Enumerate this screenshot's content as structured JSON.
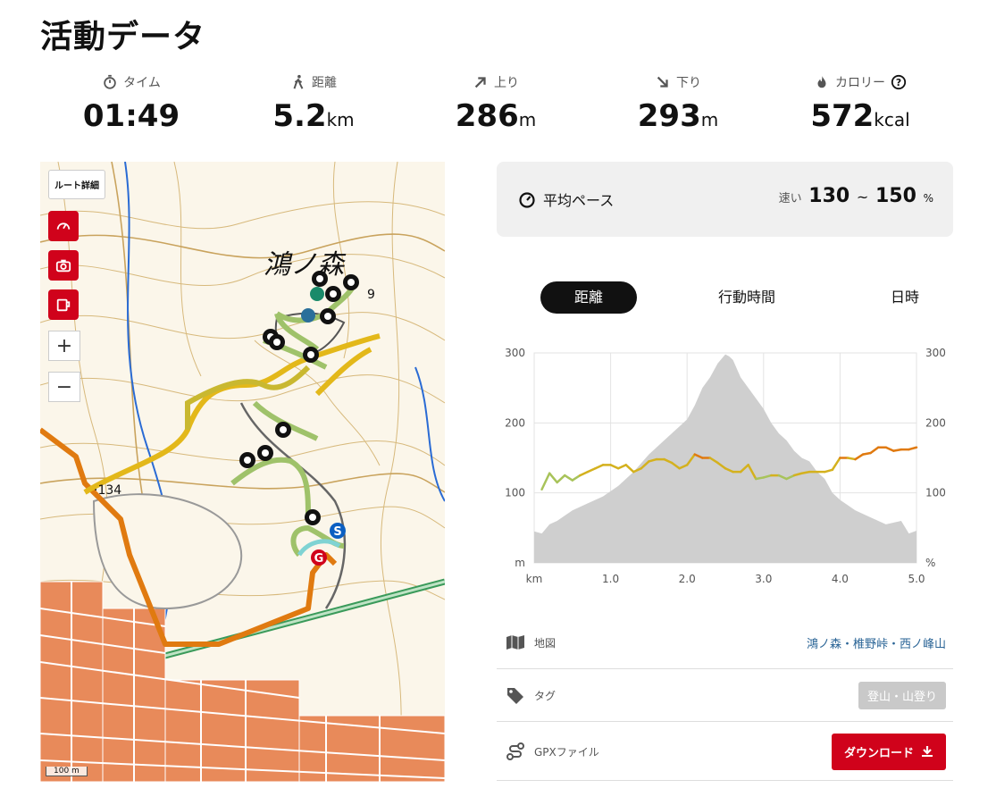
{
  "title": "活動データ",
  "stats": [
    {
      "icon": "stopwatch-icon",
      "label": "タイム",
      "value": "01:49",
      "unit": ""
    },
    {
      "icon": "walker-icon",
      "label": "距離",
      "value": "5.2",
      "unit": "km"
    },
    {
      "icon": "arrow-up-right-icon",
      "label": "上り",
      "value": "286",
      "unit": "m"
    },
    {
      "icon": "arrow-down-right-icon",
      "label": "下り",
      "value": "293",
      "unit": "m"
    },
    {
      "icon": "flame-icon",
      "label": "カロリー",
      "value": "572",
      "unit": "kcal"
    }
  ],
  "map": {
    "route_detail": "ルート詳細",
    "zoom_in": "+",
    "zoom_out": "−",
    "place_label": "鴻ノ森",
    "elev_label": "·134",
    "elev_label2": "9",
    "scale": "100 m",
    "colors": {
      "route_low": "#9fc26a",
      "route_mid": "#e3b81a",
      "route_high": "#e07a10",
      "start": "#0b5fc2",
      "goal": "#d0021b"
    }
  },
  "pace": {
    "label": "平均ペース",
    "prefix": "速い",
    "low": "130",
    "sep": "~",
    "high": "150",
    "unit": "%"
  },
  "tabs": [
    {
      "label": "距離",
      "active": true
    },
    {
      "label": "行動時間",
      "active": false
    },
    {
      "label": "日時",
      "active": false
    }
  ],
  "chart_data": {
    "type": "area",
    "x_unit": "km",
    "left_unit": "m",
    "right_unit": "%",
    "xlim": [
      0,
      5.0
    ],
    "ylim": [
      0,
      300
    ],
    "x_ticks": [
      "km",
      "1.0",
      "2.0",
      "3.0",
      "4.0",
      "5.0"
    ],
    "y_ticks_left": [
      "300",
      "200",
      "100",
      "m"
    ],
    "y_ticks_right": [
      "300",
      "200",
      "100",
      "%"
    ],
    "series": [
      {
        "kind": "elevation",
        "color": "#cfcfcf",
        "x": [
          0,
          0.1,
          0.2,
          0.3,
          0.5,
          0.7,
          0.9,
          1.1,
          1.3,
          1.5,
          1.7,
          1.9,
          2.0,
          2.1,
          2.2,
          2.3,
          2.4,
          2.5,
          2.55,
          2.6,
          2.7,
          2.8,
          2.9,
          3.0,
          3.1,
          3.2,
          3.3,
          3.4,
          3.5,
          3.6,
          3.7,
          3.8,
          3.9,
          4.0,
          4.2,
          4.4,
          4.6,
          4.8,
          4.9,
          5.0
        ],
        "y": [
          45,
          42,
          55,
          60,
          75,
          85,
          95,
          110,
          130,
          155,
          175,
          195,
          205,
          225,
          250,
          265,
          285,
          298,
          295,
          290,
          265,
          250,
          235,
          220,
          200,
          185,
          175,
          160,
          150,
          145,
          130,
          120,
          100,
          90,
          75,
          65,
          55,
          60,
          42,
          46
        ]
      },
      {
        "kind": "pace",
        "color": "#e3b81a",
        "x": [
          0.1,
          0.2,
          0.3,
          0.4,
          0.5,
          0.6,
          0.7,
          0.8,
          0.9,
          1.0,
          1.1,
          1.2,
          1.3,
          1.4,
          1.5,
          1.6,
          1.7,
          1.8,
          1.9,
          2.0,
          2.1,
          2.2,
          2.3,
          2.4,
          2.5,
          2.6,
          2.7,
          2.8,
          2.9,
          3.0,
          3.1,
          3.2,
          3.3,
          3.4,
          3.5,
          3.6,
          3.7,
          3.8,
          3.9,
          4.0,
          4.1,
          4.2,
          4.3,
          4.4,
          4.5,
          4.6,
          4.7,
          4.8,
          4.9,
          5.0
        ],
        "y": [
          105,
          128,
          115,
          125,
          118,
          125,
          130,
          135,
          140,
          140,
          135,
          140,
          130,
          135,
          145,
          148,
          148,
          143,
          135,
          140,
          155,
          150,
          150,
          143,
          135,
          130,
          130,
          140,
          120,
          122,
          125,
          125,
          120,
          125,
          128,
          130,
          130,
          130,
          133,
          150,
          150,
          148,
          155,
          157,
          165,
          165,
          160,
          162,
          162,
          165
        ]
      }
    ]
  },
  "info_rows": [
    {
      "icon": "map-icon",
      "label": "地図",
      "value": "鴻ノ森・椎野峠・西ノ峰山"
    },
    {
      "icon": "tag-icon",
      "label": "タグ",
      "value": "登山・山登り"
    },
    {
      "icon": "route-icon",
      "label": "GPXファイル",
      "value": "ダウンロード"
    }
  ]
}
